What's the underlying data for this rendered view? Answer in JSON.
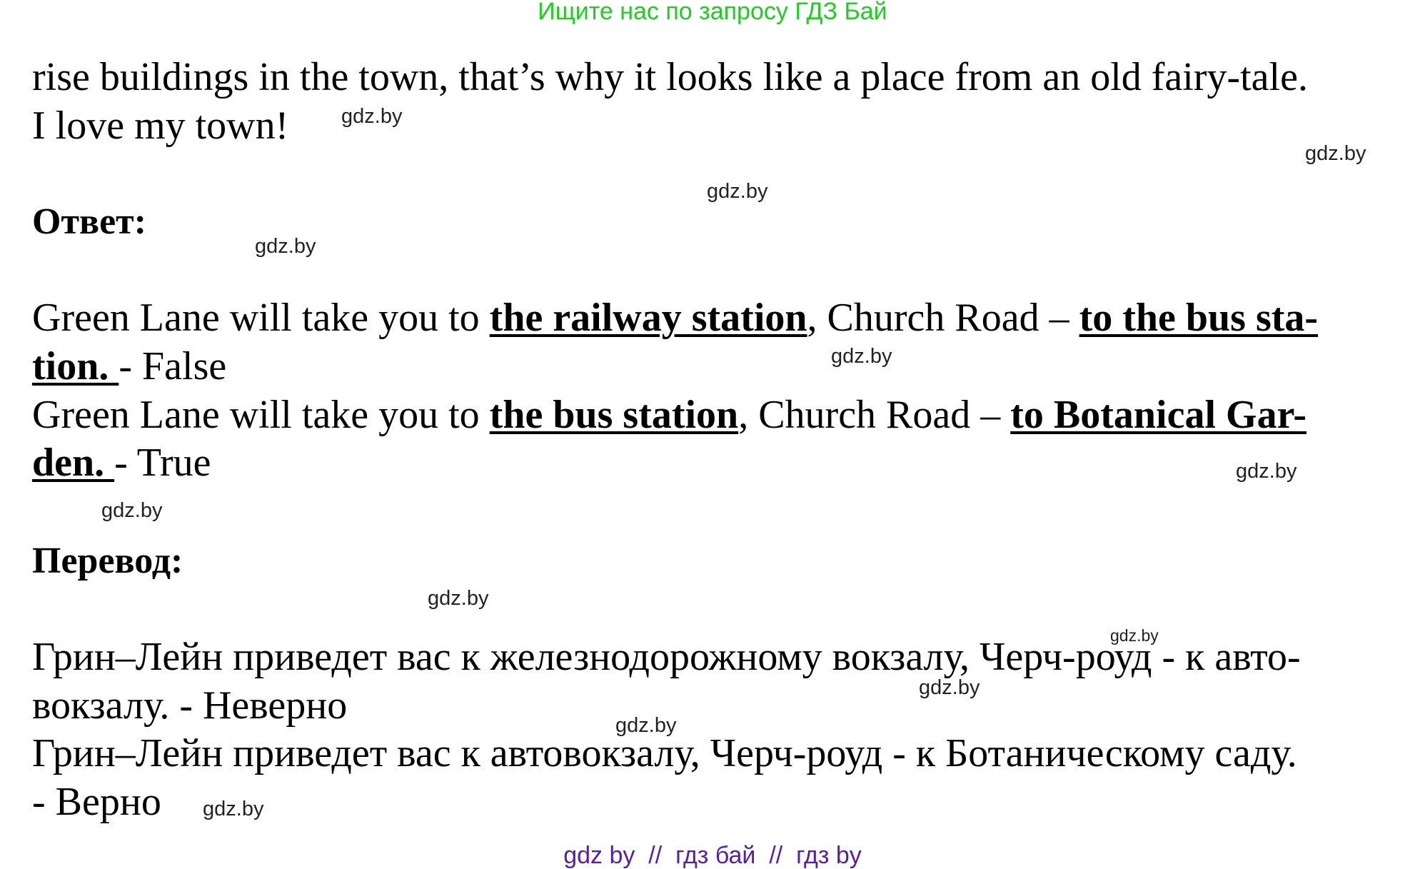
{
  "banner": "Ищите нас по запросу ГДЗ Бай",
  "intro": {
    "line1": "rise buildings in the town, that’s why it looks like a place from an old fairy-tale.",
    "line2": "I love my town!"
  },
  "answer_heading": "Ответ:",
  "answers": [
    {
      "l1_pre": "Green Lane will take you to ",
      "l1_hl1": "the railway station",
      "l1_mid": ", Church Road – ",
      "l1_hl2": "to the bus sta-",
      "l2_hl": "tion. ",
      "l2_post": "- False"
    },
    {
      "l1_pre": "Green Lane will take you to ",
      "l1_hl1": "the bus station",
      "l1_mid": ", Church Road – ",
      "l1_hl2": "to Botanical Gar-",
      "l2_hl": "den. ",
      "l2_post": "- True"
    }
  ],
  "translation_heading": "Перевод:",
  "translation_lines": [
    "Грин–Лейн приведет вас к железнодорожному вокзалу, Черч-роуд - к авто-",
    "вокзалу. - Неверно",
    "Грин–Лейн приведет вас к автовокзалу, Черч-роуд - к Ботаническому саду.",
    "- Верно"
  ],
  "watermark": "gdz.by",
  "footer": "gdz by  //  гдз бай  //  гдз by"
}
